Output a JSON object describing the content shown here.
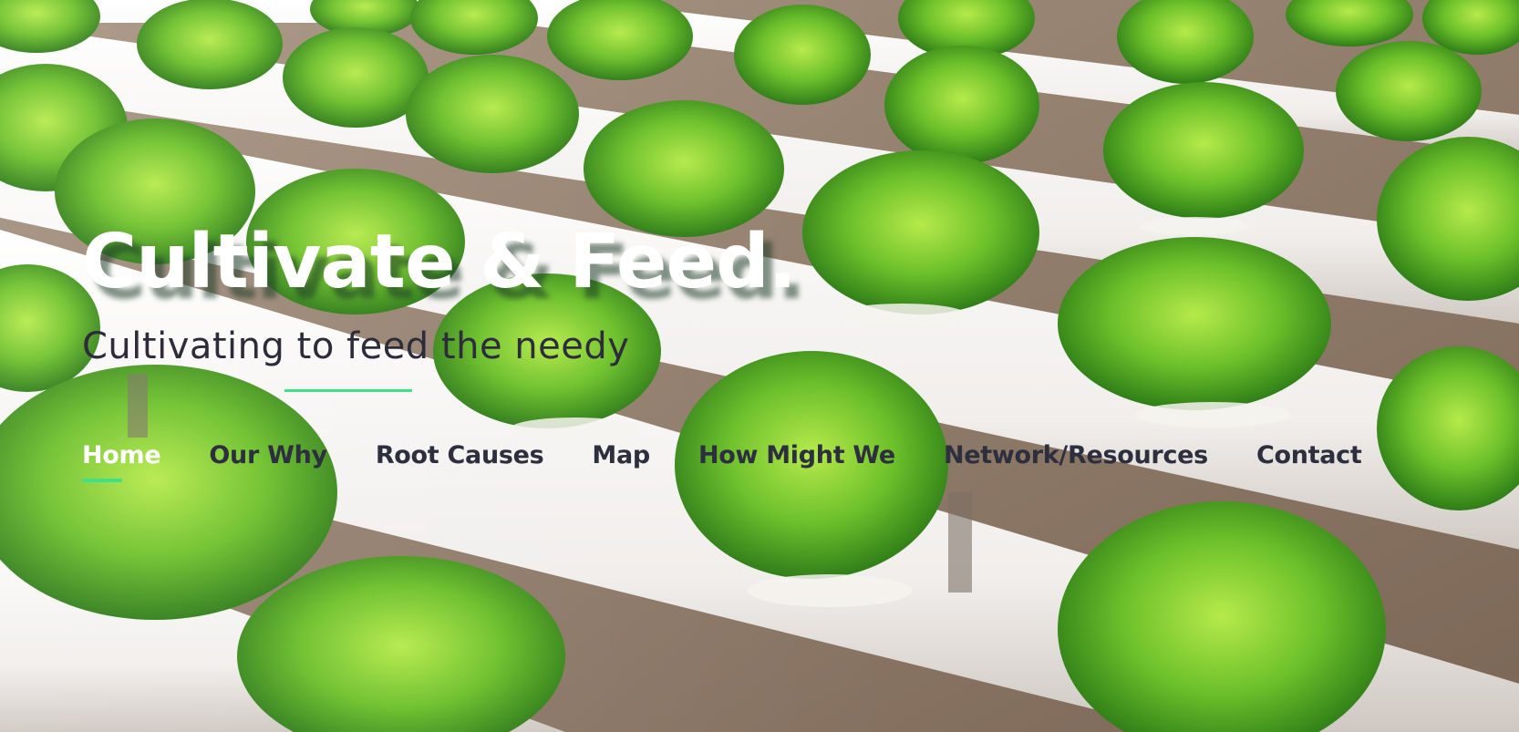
{
  "hero": {
    "title": "Cultivate & Feed.",
    "subtitle": "Cultivating to feed the needy"
  },
  "nav": {
    "items": [
      {
        "label": "Home",
        "active": true
      },
      {
        "label": "Our Why",
        "active": false
      },
      {
        "label": "Root Causes",
        "active": false
      },
      {
        "label": "Map",
        "active": false
      },
      {
        "label": "How Might We",
        "active": false
      },
      {
        "label": "Network/Resources",
        "active": false
      },
      {
        "label": "Contact",
        "active": false
      }
    ]
  },
  "colors": {
    "accent": "#3fe08a",
    "nav_text": "#2d2f3e",
    "title_text": "#ffffff",
    "subtitle_text": "#2c2c3a"
  },
  "background": {
    "icon": "hydroponic-lettuce-photo"
  }
}
